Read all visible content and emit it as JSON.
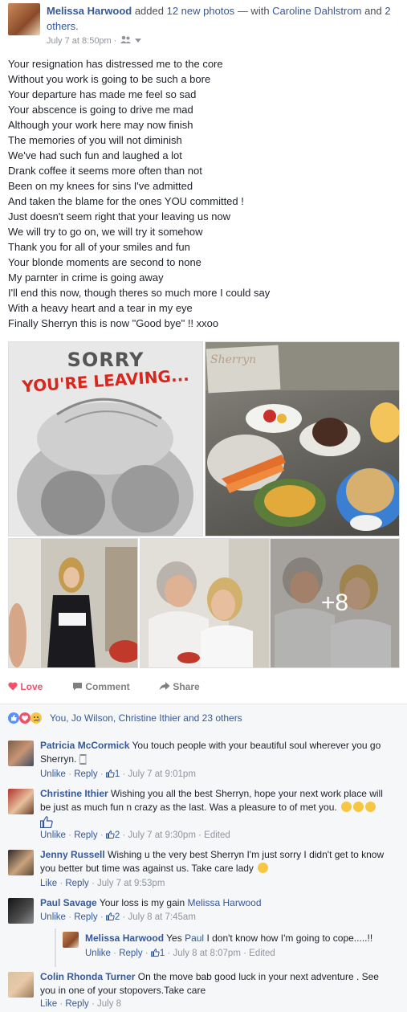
{
  "post": {
    "author": "Melissa Harwood",
    "added": "added",
    "photos_count": "12 new photos",
    "with_sep": "— with",
    "tagged": "Caroline Dahlstrom",
    "and": "and",
    "others": "2 others.",
    "timestamp": "July 7 at 8:50pm",
    "audience_icon": "friends-icon",
    "lines": [
      "Your resignation has distressed me to the core",
      "Without you work is going to be such a bore",
      "Your departure has made me feel so sad",
      "Your abscence is going to drive me mad",
      "Although your work here may now finish",
      "The memories of you will not diminish",
      "We've had such fun and laughed a lot",
      "Drank coffee it seems more often than not",
      "Been on my knees for sins I've admitted",
      "And taken the blame for the ones YOU committed !",
      "Just doesn't seem right that your leaving us now",
      "We will try to go on, we will try it somehow",
      "Thank you for all of your smiles and fun",
      "Your blonde moments are second to none",
      "My parnter in crime is going away",
      "I'll end this now, though theres so much more I could say",
      "With a heavy heart and a tear in my eye",
      "Finally Sherryn this is now \"Good bye\" !! xxoo"
    ]
  },
  "photos": {
    "sorry_line1": "SORRY",
    "sorry_line2": "YOU'RE LEAVING...",
    "card_text": "Sherryn",
    "more_count": "+8"
  },
  "actions": {
    "love": "Love",
    "comment": "Comment",
    "share": "Share"
  },
  "reactions": {
    "summary": "You, Jo Wilson, Christine Ithier and 23 others"
  },
  "comments": [
    {
      "name": "Patricia McCormick",
      "text": "You touch people with your beautiful soul wherever you go Sherryn. 🀆",
      "action": "Unlike",
      "reply": "Reply",
      "likes": "1",
      "time": "July 7 at 9:01pm",
      "edited": ""
    },
    {
      "name": "Christine Ithier",
      "text": "Wishing you all the best Sherryn, hope your next work place will be just as much fun n crazy as the last. Was a pleasure to of met you.",
      "action": "Unlike",
      "reply": "Reply",
      "likes": "2",
      "time": "July 7 at 9:30pm",
      "edited": "Edited"
    },
    {
      "name": "Jenny Russell",
      "text": "Wishing u the very best Sherryn I'm just sorry I didn't get to know you better but time was against us. Take care lady",
      "action": "Like",
      "reply": "Reply",
      "likes": "",
      "time": "July 7 at 9:53pm",
      "edited": ""
    },
    {
      "name": "Paul Savage",
      "text": "Your loss is my gain",
      "mention": "Melissa Harwood",
      "action": "Unlike",
      "reply": "Reply",
      "likes": "2",
      "time": "July 8 at 7:45am",
      "edited": ""
    },
    {
      "name": "Melissa Harwood",
      "pre": "Yes",
      "mention": "Paul",
      "text": "I don't know how I'm going to cope.....!!",
      "action": "Unlike",
      "reply": "Reply",
      "likes": "1",
      "time": "July 8 at 8:07pm",
      "edited": "Edited"
    },
    {
      "name": "Colin Rhonda Turner",
      "text": "On the move bab good luck in your next adventure . See you in one of your stopovers.Take care",
      "action": "Like",
      "reply": "Reply",
      "likes": "",
      "time": "July 8",
      "edited": ""
    }
  ],
  "sep": "·",
  "colors": {
    "link": "#365899",
    "love": "#f25268",
    "meta": "#90949c"
  }
}
